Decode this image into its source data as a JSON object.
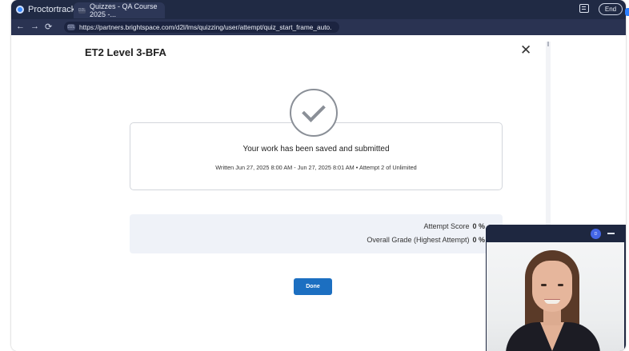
{
  "app": {
    "name": "Proctortrack",
    "end_label": "End"
  },
  "browser": {
    "tab_title": "Quizzes - QA Course 2025 -...",
    "tab_favicon_text": "D2L",
    "url": "https://partners.brightspace.com/d2l/lms/quizzing/user/attempt/quiz_start_frame_auto.",
    "url_favicon_text": "D2L"
  },
  "page": {
    "title": "ET2 Level 3-BFA",
    "close_glyph": "✕"
  },
  "submission": {
    "message": "Your work has been saved and submitted",
    "details": "Written Jun 27, 2025 8:00 AM - Jun 27, 2025 8:01 AM • Attempt 2 of Unlimited"
  },
  "grades": {
    "attempt_score_label": "Attempt Score",
    "attempt_score_value": "0 %",
    "overall_grade_label": "Overall Grade (Highest Attempt)",
    "overall_grade_value": "0 %"
  },
  "actions": {
    "done_label": "Done"
  },
  "video": {
    "avatar_text": "D"
  },
  "colors": {
    "appbar": "#202a44",
    "primary_button": "#1c6fc1",
    "grade_panel": "#eff2f8"
  },
  "icons": [
    "proctortrack-logo-icon",
    "chat-icon",
    "back-arrow-icon",
    "forward-arrow-icon",
    "reload-icon",
    "close-icon",
    "check-circle-icon",
    "minimize-icon"
  ]
}
